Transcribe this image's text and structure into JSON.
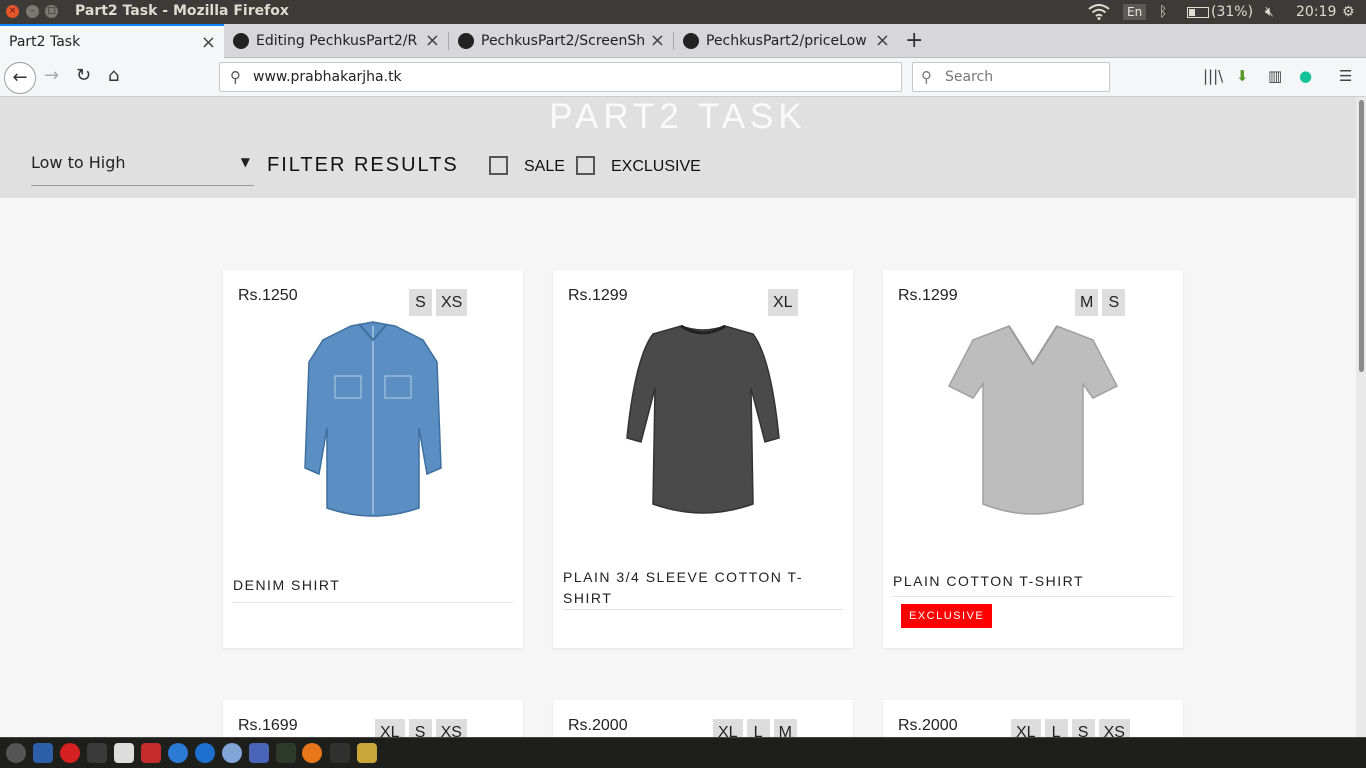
{
  "window": {
    "title": "Part2 Task - Mozilla Firefox"
  },
  "tray": {
    "language": "En",
    "battery": "(31%)",
    "time": "20:19"
  },
  "tabs": [
    {
      "label": "Part2 Task",
      "active": true
    },
    {
      "label": "Editing PechkusPart2/R",
      "active": false
    },
    {
      "label": "PechkusPart2/ScreenSh",
      "active": false
    },
    {
      "label": "PechkusPart2/priceLow",
      "active": false
    }
  ],
  "nav": {
    "url": "www.prabhakarjha.tk",
    "search_placeholder": "Search"
  },
  "page": {
    "title": "PART2 TASK",
    "sort_value": "Low to High",
    "filter_label": "FILTER RESULTS",
    "filters": [
      {
        "label": "SALE",
        "checked": false
      },
      {
        "label": "EXCLUSIVE",
        "checked": false
      }
    ]
  },
  "products": [
    {
      "price": "Rs.1250",
      "sizes": [
        "S",
        "XS"
      ],
      "name": "DENIM SHIRT",
      "badge": "",
      "image": "denim-shirt",
      "color": "#5b8fc4"
    },
    {
      "price": "Rs.1299",
      "sizes": [
        "XL"
      ],
      "name": "PLAIN 3/4 SLEEVE COTTON T-SHIRT",
      "badge": "",
      "image": "dark-grey-tshirt",
      "color": "#4a4a4a"
    },
    {
      "price": "Rs.1299",
      "sizes": [
        "M",
        "S"
      ],
      "name": "PLAIN COTTON T-SHIRT",
      "badge": "EXCLUSIVE",
      "image": "light-grey-tshirt",
      "color": "#bdbdbd"
    },
    {
      "price": "Rs.1699",
      "sizes": [
        "XL",
        "S",
        "XS"
      ],
      "name": "",
      "badge": ""
    },
    {
      "price": "Rs.2000",
      "sizes": [
        "XL",
        "L",
        "M"
      ],
      "name": "",
      "badge": ""
    },
    {
      "price": "Rs.2000",
      "sizes": [
        "XL",
        "L",
        "S",
        "XS"
      ],
      "name": "",
      "badge": ""
    }
  ],
  "colors": {
    "accent": "#0a84ff",
    "badge": "#ff0000",
    "header_bg": "#e0e0e0"
  }
}
